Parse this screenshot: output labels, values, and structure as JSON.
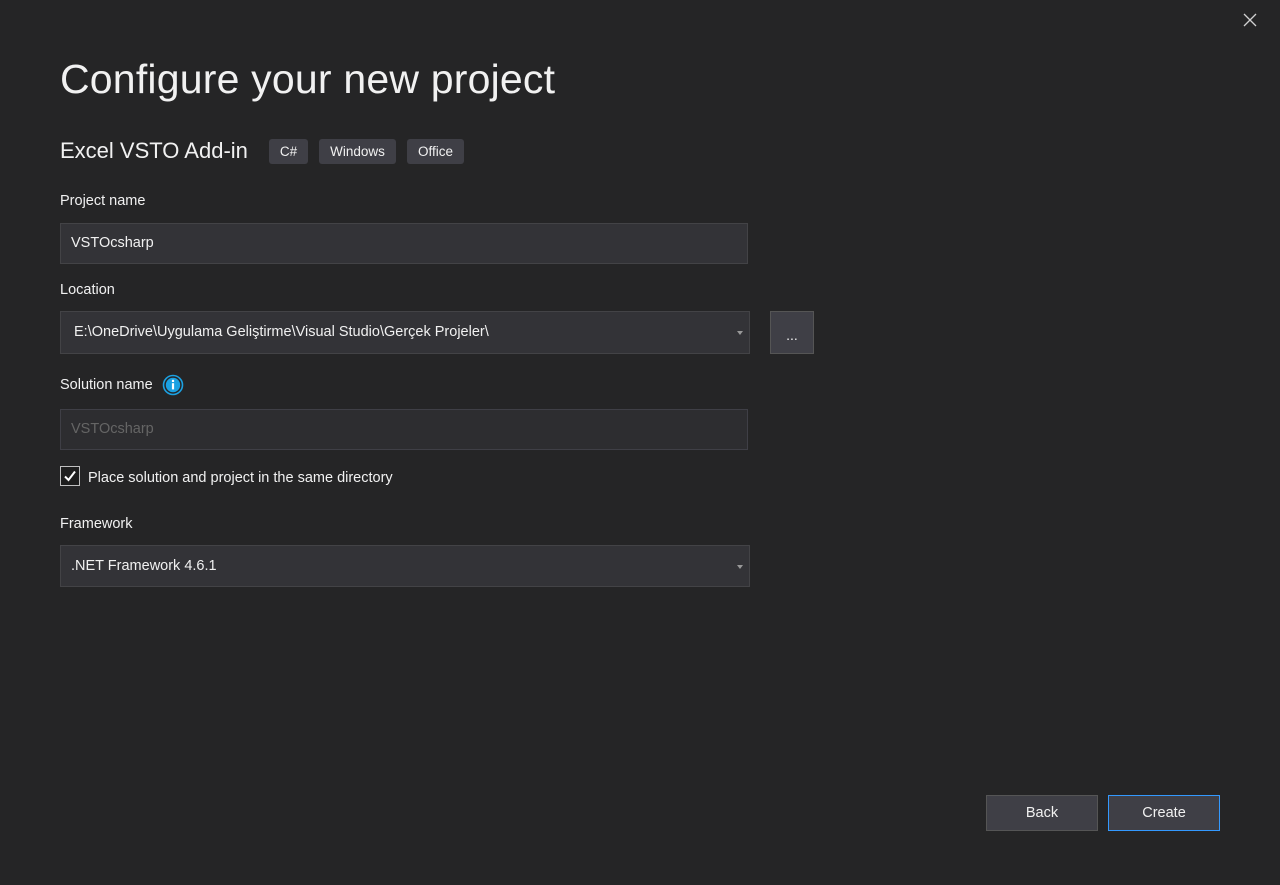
{
  "dialog": {
    "title": "Configure your new project",
    "close_icon": "close-icon"
  },
  "template": {
    "name": "Excel VSTO Add-in",
    "tags": [
      "C#",
      "Windows",
      "Office"
    ]
  },
  "project_name": {
    "label": "Project name",
    "value": "VSTOcsharp"
  },
  "location": {
    "label": "Location",
    "value": "E:\\OneDrive\\Uygulama Geliştirme\\Visual Studio\\Gerçek Projeler\\",
    "browse_label": "..."
  },
  "solution_name": {
    "label": "Solution name",
    "value": "VSTOcsharp",
    "info_icon": "info-icon",
    "disabled": true
  },
  "same_directory": {
    "label": "Place solution and project in the same directory",
    "checked": true
  },
  "framework": {
    "label": "Framework",
    "value": ".NET Framework 4.6.1"
  },
  "buttons": {
    "back": "Back",
    "create": "Create"
  },
  "colors": {
    "background": "#252526",
    "input_bg": "#333337",
    "accent": "#3399ff",
    "info": "#1ba1e2"
  }
}
